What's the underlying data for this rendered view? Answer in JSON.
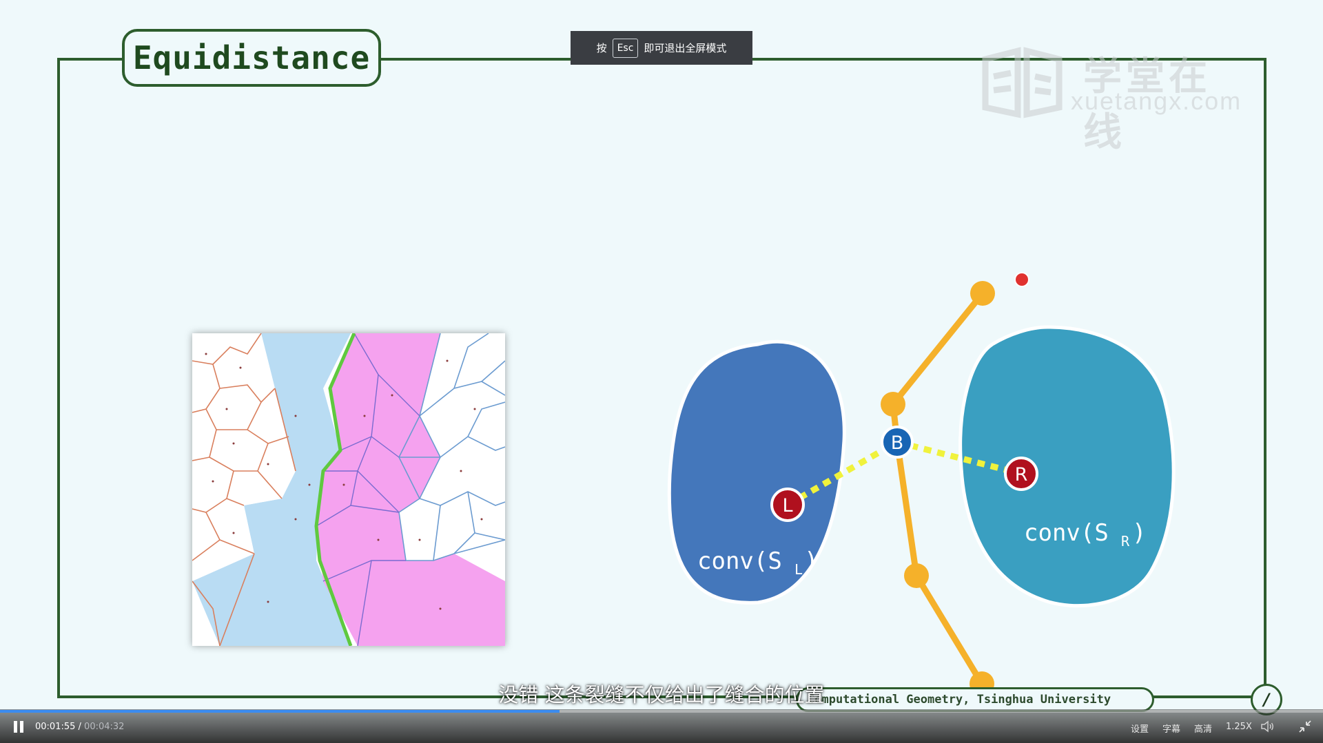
{
  "slide": {
    "title": "Equidistance",
    "footer": "Computational Geometry, Tsinghua University",
    "page_marker": "/",
    "watermark_cn": "学堂在线",
    "watermark_en": "xuetangx.com",
    "labels": {
      "left_hull": "conv(S",
      "left_sub": "L",
      "right_hull": "conv(S",
      "right_sub": "R",
      "point_L": "L",
      "point_B": "B",
      "point_R": "R",
      "close_paren": ")"
    }
  },
  "esc_hint": {
    "prefix": "按",
    "key": "Esc",
    "suffix": "即可退出全屏模式"
  },
  "subtitle": "没错 这条裂缝不仅给出了缝合的位置",
  "player": {
    "current_time": "00:01:55",
    "separator": " / ",
    "duration": "00:04:32",
    "progress": 0.4228,
    "settings_label": "设置",
    "captions_label": "字幕",
    "quality_label": "高清",
    "speed_label": "1.25X",
    "icons": {
      "play": "pause-icon",
      "volume": "volume-icon",
      "fullscreen": "exit-fullscreen-icon"
    }
  },
  "colors": {
    "frame": "#2d5d2d",
    "left_hull": "#4477bb",
    "right_hull": "#3a9fc1",
    "chain": "#f5b12a",
    "dotted": "#f0f23c",
    "marker_red": "#b0101e",
    "marker_blue": "#1865b4",
    "progress": "#3b8cf0"
  }
}
